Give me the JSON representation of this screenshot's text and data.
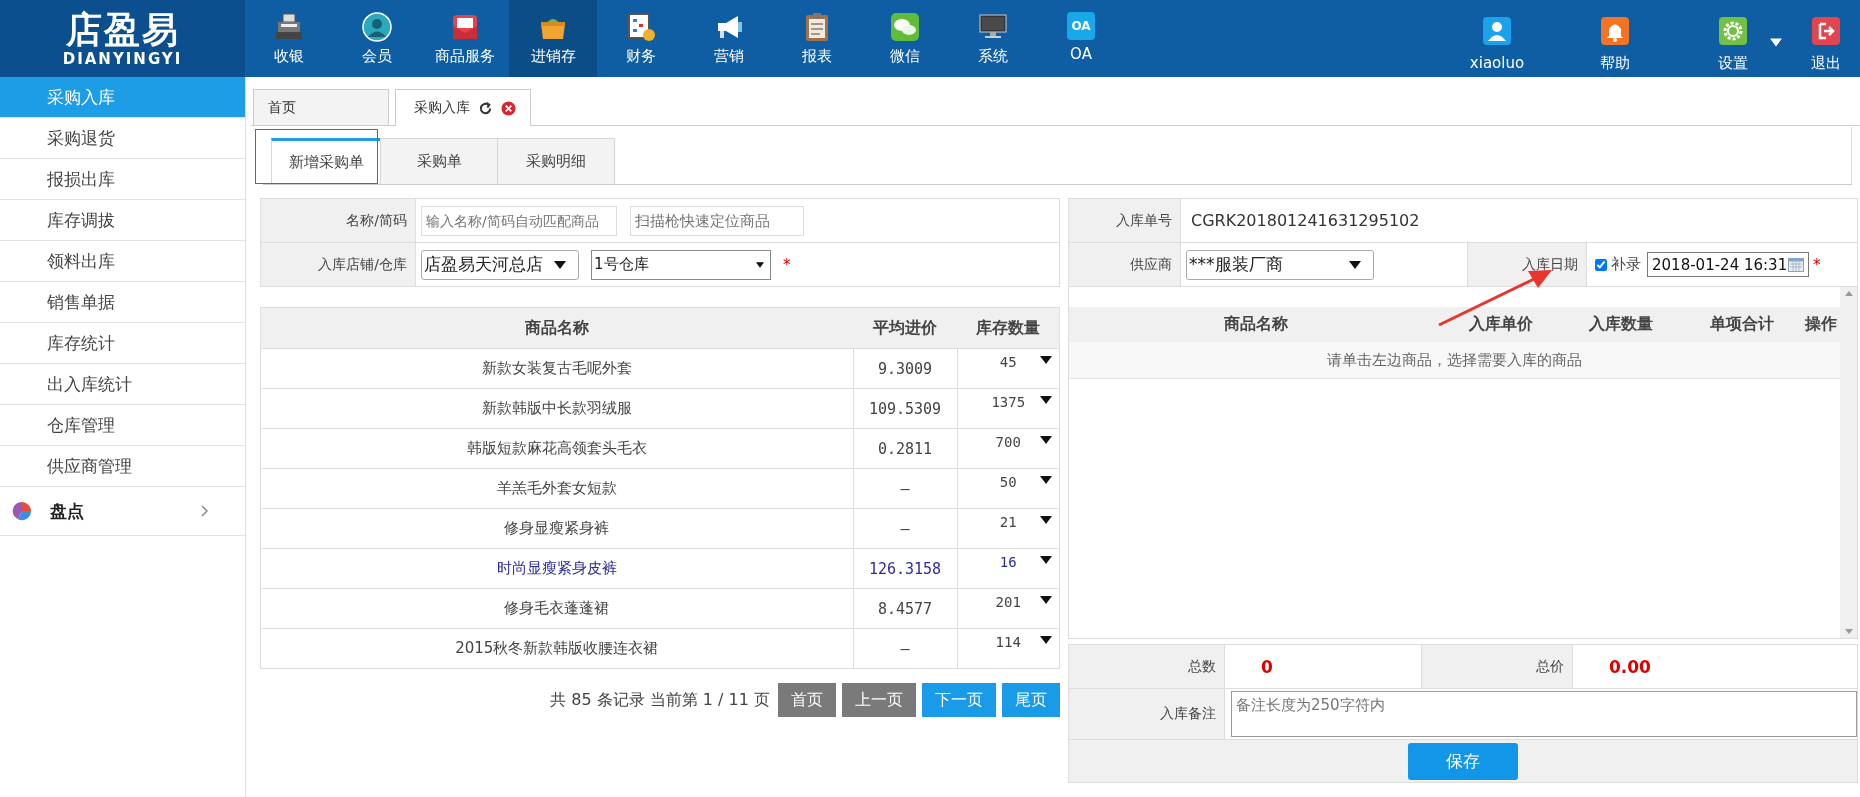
{
  "logo": {
    "title": "店盈易",
    "subtitle": "DIANYINGYI"
  },
  "nav": [
    {
      "label": "收银",
      "kind": "register",
      "selected": false
    },
    {
      "label": "会员",
      "kind": "member",
      "selected": false
    },
    {
      "label": "商品服务",
      "kind": "goods",
      "selected": false
    },
    {
      "label": "进销存",
      "kind": "inventory",
      "selected": true
    },
    {
      "label": "财务",
      "kind": "finance",
      "selected": false
    },
    {
      "label": "营销",
      "kind": "marketing",
      "selected": false
    },
    {
      "label": "报表",
      "kind": "report",
      "selected": false
    },
    {
      "label": "微信",
      "kind": "wechat",
      "selected": false
    },
    {
      "label": "系统",
      "kind": "system",
      "selected": false
    },
    {
      "label": "OA",
      "kind": "badge",
      "badge": "OA",
      "selected": false
    }
  ],
  "user_menu": [
    {
      "label": "xiaoluo",
      "kind": "user",
      "dropdown": false
    },
    {
      "label": "帮助",
      "kind": "help",
      "dropdown": false
    },
    {
      "label": "设置",
      "kind": "settings",
      "dropdown": true
    },
    {
      "label": "退出",
      "kind": "logout",
      "dropdown": false
    }
  ],
  "sidebar": {
    "items": [
      {
        "label": "采购入库",
        "selected": true
      },
      {
        "label": "采购退货",
        "selected": false
      },
      {
        "label": "报损出库",
        "selected": false
      },
      {
        "label": "库存调拔",
        "selected": false
      },
      {
        "label": "领料出库",
        "selected": false
      },
      {
        "label": "销售单据",
        "selected": false
      },
      {
        "label": "库存统计",
        "selected": false
      },
      {
        "label": "出入库统计",
        "selected": false
      },
      {
        "label": "仓库管理",
        "selected": false
      },
      {
        "label": "供应商管理",
        "selected": false
      }
    ],
    "groups": [
      {
        "label": "盘点",
        "expanded": false
      }
    ]
  },
  "tabs": [
    {
      "label": "首页",
      "selected": false,
      "closable": false
    },
    {
      "label": "采购入库",
      "selected": true,
      "closable": true
    }
  ],
  "subtabs": [
    {
      "label": "新增采购单",
      "selected": true,
      "highlighted": true
    },
    {
      "label": "采购单",
      "selected": false,
      "highlighted": false
    },
    {
      "label": "采购明细",
      "selected": false,
      "highlighted": false
    }
  ],
  "search": {
    "label": "名称/简码",
    "name_placeholder": "输入名称/简码自动匹配商品",
    "scan_placeholder": "扫描枪快速定位商品"
  },
  "location": {
    "label": "入库店铺/仓库",
    "store": "店盈易天河总店",
    "warehouse": "1号仓库",
    "required": "*"
  },
  "products": {
    "columns": [
      "商品名称",
      "平均进价",
      "库存数量"
    ],
    "rows": [
      {
        "name": "新款女装复古毛呢外套",
        "price": "9.3009",
        "stock": "45",
        "selected": false
      },
      {
        "name": "新款韩版中长款羽绒服",
        "price": "109.5309",
        "stock": "1375",
        "selected": false
      },
      {
        "name": "韩版短款麻花高领套头毛衣",
        "price": "0.2811",
        "stock": "700",
        "selected": false
      },
      {
        "name": "羊羔毛外套女短款",
        "price": "–",
        "stock": "50",
        "selected": false
      },
      {
        "name": "修身显瘦紧身裤",
        "price": "–",
        "stock": "21",
        "selected": false
      },
      {
        "name": "时尚显瘦紧身皮裤",
        "price": "126.3158",
        "stock": "16",
        "selected": true
      },
      {
        "name": "修身毛衣蓬蓬裙",
        "price": "8.4577",
        "stock": "201",
        "selected": false
      },
      {
        "name": "2015秋冬新款韩版收腰连衣裙",
        "price": "–",
        "stock": "114",
        "selected": false
      }
    ]
  },
  "pagination": {
    "summary": "共 85 条记录 当前第 1 / 11 页",
    "buttons": [
      {
        "label": "首页",
        "disabled": true
      },
      {
        "label": "上一页",
        "disabled": true
      },
      {
        "label": "下一页",
        "disabled": false
      },
      {
        "label": "尾页",
        "disabled": false
      }
    ]
  },
  "order": {
    "number_label": "入库单号",
    "number": "CGRK201801241631295102",
    "supplier_label": "供应商",
    "supplier": "***服装厂商",
    "date_label": "入库日期",
    "backfill_label": "补录",
    "backfill_checked": true,
    "date": "2018-01-24 16:31",
    "required": "*"
  },
  "order_items": {
    "columns": [
      "商品名称",
      "入库单价",
      "入库数量",
      "单项合计",
      "操作"
    ],
    "empty_message": "请单击左边商品，选择需要入库的商品"
  },
  "totals": {
    "count_label": "总数",
    "count": "0",
    "price_label": "总价",
    "price": "0.00",
    "note_label": "入库备注",
    "note_placeholder": "备注长度为250字符内"
  },
  "save_button": "保存",
  "annotations": [
    {
      "kind": "arrow"
    }
  ]
}
